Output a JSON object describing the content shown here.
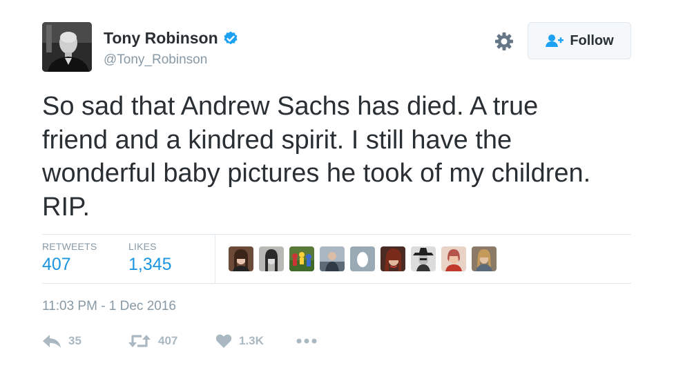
{
  "author": {
    "name": "Tony Robinson",
    "handle": "@Tony_Robinson",
    "verified": true,
    "avatar_icon": "profile-photo-icon"
  },
  "header": {
    "settings_icon": "gear-icon",
    "follow_label": "Follow",
    "follow_icon": "add-user-icon"
  },
  "tweet": {
    "lines": [
      "So sad that Andrew Sachs has died. A true",
      "friend and a kindred spirit. I still have the",
      "wonderful baby pictures he took of my children.",
      "RIP."
    ]
  },
  "stats": {
    "retweets_label": "RETWEETS",
    "retweets_value": "407",
    "likes_label": "LIKES",
    "likes_value": "1,345"
  },
  "likers": [
    {
      "name": "liker-avatar-1",
      "color": "#6b4a3a"
    },
    {
      "name": "liker-avatar-2",
      "color": "#8a8a86"
    },
    {
      "name": "liker-avatar-3",
      "color": "#5a7a3a"
    },
    {
      "name": "liker-avatar-4",
      "color": "#7f8c97"
    },
    {
      "name": "liker-avatar-egg",
      "color": "#99aab5"
    },
    {
      "name": "liker-avatar-6",
      "color": "#4a2a22"
    },
    {
      "name": "liker-avatar-7",
      "color": "#3a3a3a"
    },
    {
      "name": "liker-avatar-8",
      "color": "#b5544a"
    },
    {
      "name": "liker-avatar-9",
      "color": "#8a7a66"
    }
  ],
  "timestamp": "11:03 PM - 1 Dec 2016",
  "actions": {
    "reply_count": "35",
    "retweet_count": "407",
    "like_count": "1.3K",
    "more_icon": "more-dots-icon"
  },
  "colors": {
    "accent": "#1b95e0",
    "verified": "#1da1f2",
    "muted": "#8899a6",
    "action": "#aab8c2"
  }
}
